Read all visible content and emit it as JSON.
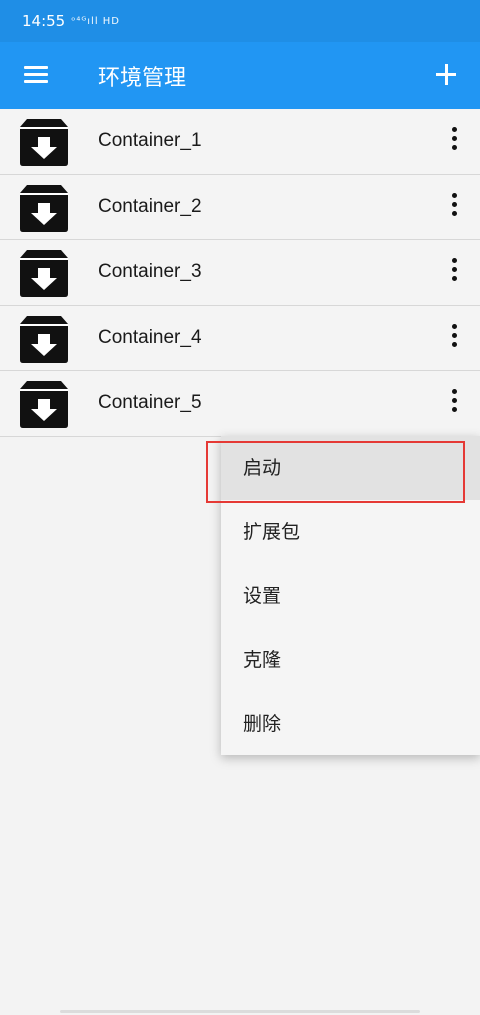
{
  "status_bar": {
    "time": "14:55",
    "signal_text": "ᵒ⁴ᴳıll HD"
  },
  "app_bar": {
    "title": "环境管理",
    "menu_icon": "hamburger-icon",
    "add_icon": "plus-icon"
  },
  "containers": [
    {
      "name": "Container_1"
    },
    {
      "name": "Container_2"
    },
    {
      "name": "Container_3"
    },
    {
      "name": "Container_4"
    },
    {
      "name": "Container_5"
    }
  ],
  "context_menu": {
    "items": [
      {
        "label": "启动"
      },
      {
        "label": "扩展包"
      },
      {
        "label": "设置"
      },
      {
        "label": "克隆"
      },
      {
        "label": "删除"
      }
    ],
    "highlight_color": "#e53935"
  },
  "colors": {
    "app_bar": "#2196f3",
    "status_bar": "#1f8ee6"
  }
}
